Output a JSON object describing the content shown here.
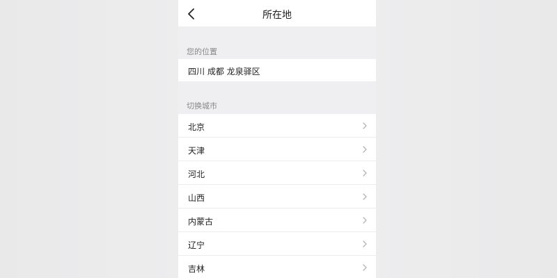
{
  "header": {
    "title": "所在地",
    "back_icon": "chevron-left-icon"
  },
  "location": {
    "section_label": "您的位置",
    "current": "四川 成都 龙泉驿区"
  },
  "cities": {
    "section_label": "切换城市",
    "row_icon": "chevron-right-icon",
    "items": [
      {
        "label": "北京"
      },
      {
        "label": "天津"
      },
      {
        "label": "河北"
      },
      {
        "label": "山西"
      },
      {
        "label": "内蒙古"
      },
      {
        "label": "辽宁"
      },
      {
        "label": "吉林"
      }
    ]
  },
  "colors": {
    "background": "#efeff1",
    "surface": "#ffffff",
    "text_primary": "#222222",
    "text_secondary": "#888888",
    "divider": "#ececec",
    "chevron": "#b5b5b5"
  }
}
